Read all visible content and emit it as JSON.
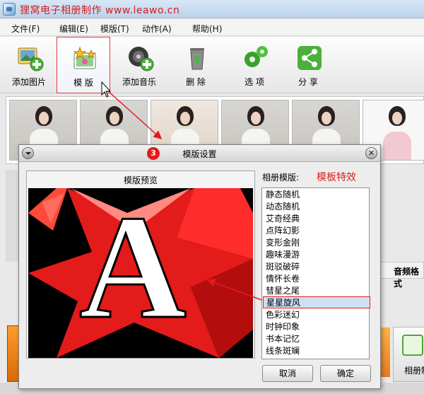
{
  "window": {
    "title": "狸窝电子相册制作 www.leawo.cn"
  },
  "menu": [
    "文件(F)",
    "编辑(E)",
    "模版(T)",
    "动作(A)",
    "帮助(H)"
  ],
  "toolbar": [
    {
      "label": "添加图片",
      "icon": "add-photo-icon"
    },
    {
      "label": "模 版",
      "icon": "template-icon",
      "selected": true
    },
    {
      "label": "添加音乐",
      "icon": "add-music-icon"
    },
    {
      "label": "删 除",
      "icon": "trash-icon"
    },
    {
      "label": "选 项",
      "icon": "gear-icon"
    },
    {
      "label": "分 享",
      "icon": "share-icon"
    }
  ],
  "background": {
    "audio_column_header": "音频格式",
    "album_button_label": "相册制"
  },
  "dialog": {
    "title": "模版设置",
    "step_number": "3",
    "preview_label": "模版预览",
    "preview_letter": "A",
    "album_template_label": "相册模版:",
    "effect_annotation": "模板特效",
    "templates": [
      "静态随机",
      "动态随机",
      "艾奇经典",
      "点阵幻影",
      "变形金刚",
      "趣味漫游",
      "斑驳破碎",
      "情怀长卷",
      "彗星之尾",
      "星星旋风",
      "色彩迷幻",
      "时钟印象",
      "书本记忆",
      "线条斑斓"
    ],
    "selected_template": "星星旋风",
    "cancel_label": "取消",
    "ok_label": "确定"
  },
  "colors": {
    "title_text": "#d21f1f",
    "annotation_red": "#e21b1b",
    "selection_blue": "#cfe0f4"
  }
}
